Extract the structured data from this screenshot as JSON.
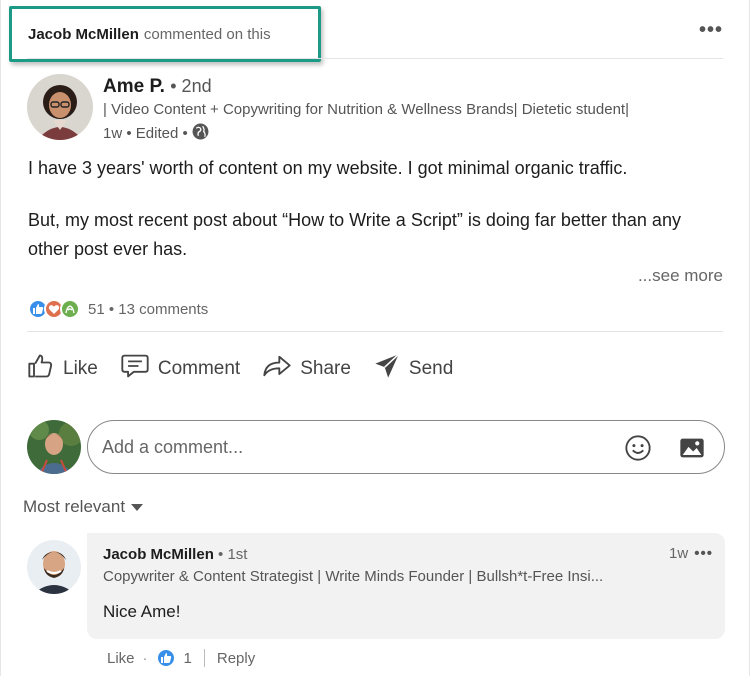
{
  "activity": {
    "actor": "Jacob McMillen",
    "action": "commented on this"
  },
  "post": {
    "author": {
      "name": "Ame P.",
      "degree": "• 2nd",
      "headline": "| Video Content + Copywriting for Nutrition & Wellness Brands| Dietetic student|",
      "time": "1w • Edited •",
      "visibility_icon": "globe-icon"
    },
    "text_lines": [
      "I have 3 years' worth of content on my website. I got minimal organic traffic.",
      "But, my most recent post about “How to Write a Script” is doing far better than any",
      "other post ever has."
    ],
    "see_more": "...see more",
    "reactions": {
      "icons": [
        "like-icon",
        "love-icon",
        "support-icon"
      ],
      "counts": "51 • 13 comments"
    }
  },
  "actions": {
    "like": "Like",
    "comment": "Comment",
    "share": "Share",
    "send": "Send"
  },
  "comment_input": {
    "placeholder": "Add a comment..."
  },
  "sort": {
    "label": "Most relevant"
  },
  "comment": {
    "name": "Jacob McMillen",
    "degree": "• 1st",
    "time": "1w",
    "headline": "Copywriter & Content Strategist | Write Minds Founder | Bullsh*t-Free Insi...",
    "text": "Nice Ame!",
    "like": "Like",
    "dot": "·",
    "reaction_count": "1",
    "reply": "Reply"
  },
  "colors": {
    "accent_border": "#1d9a86",
    "like_blue": "#378fe9",
    "love_red": "#df704d",
    "support_green": "#6dae4f"
  }
}
